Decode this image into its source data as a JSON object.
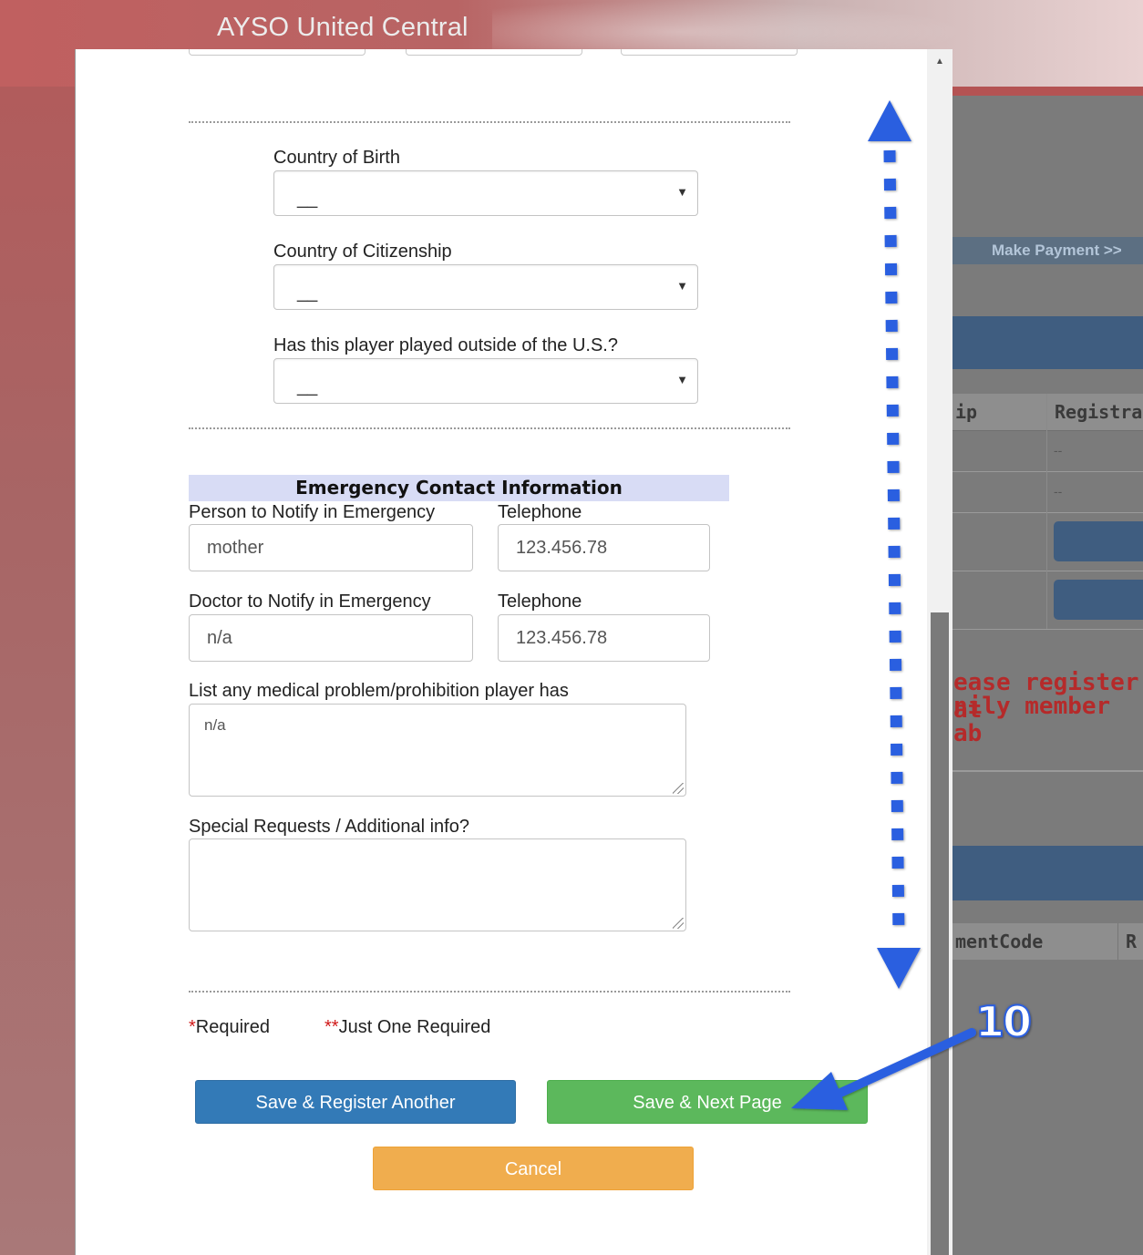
{
  "background": {
    "site_title": "AYSO United Central",
    "make_payment": "Make Payment >>",
    "table_headers": [
      "ip",
      "Registra"
    ],
    "table_dashes": [
      "--",
      "--"
    ],
    "red_text_lines": [
      "ease register at",
      "nily member ab"
    ],
    "code_header": "mentCode",
    "code_header_extra": "R"
  },
  "form": {
    "country_birth_label": "Country of Birth",
    "country_birth_value": "__",
    "country_citizenship_label": "Country of Citizenship",
    "country_citizenship_value": "__",
    "played_outside_label": "Has this player played outside of the U.S.?",
    "played_outside_value": "__",
    "emergency_section_title": "Emergency Contact Information",
    "person_label": "Person to Notify in Emergency",
    "person_value": "mother",
    "person_phone_label": "Telephone",
    "person_phone_value": "123.456.78",
    "doctor_label": "Doctor to Notify in Emergency",
    "doctor_value": "n/a",
    "doctor_phone_label": "Telephone",
    "doctor_phone_value": "123.456.78",
    "medical_label": "List any medical problem/prohibition player has",
    "medical_value": "n/a",
    "special_label": "Special Requests / Additional info?",
    "special_value": "",
    "required_star": "*",
    "required_text": "Required",
    "one_required_star": "**",
    "one_required_text": "Just One Required"
  },
  "buttons": {
    "save_register_another": "Save & Register Another",
    "save_next_page": "Save & Next Page",
    "cancel": "Cancel"
  },
  "annotation": {
    "step_number": "10",
    "color": "#2b5fe0"
  }
}
